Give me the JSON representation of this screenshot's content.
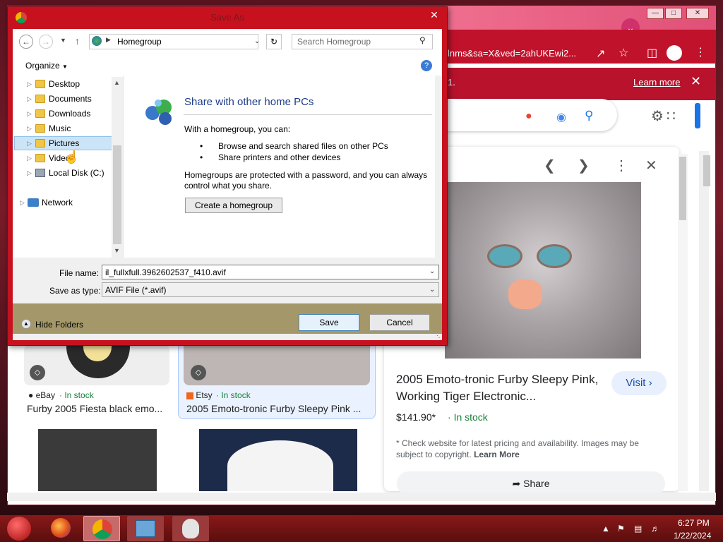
{
  "dialog": {
    "title": "Save As",
    "address": "Homegroup",
    "search_placeholder": "Search Homegroup",
    "organize_label": "Organize",
    "tree": [
      "Desktop",
      "Documents",
      "Downloads",
      "Music",
      "Pictures",
      "Videos",
      "Local Disk (C:)",
      "Network"
    ],
    "heading": "Share with other home PCs",
    "intro": "With a homegroup, you can:",
    "bullets": [
      "Browse and search shared files on other PCs",
      "Share printers and other devices"
    ],
    "protected_text": "Homegroups are protected with a password, and you can always control what you share.",
    "create_button": "Create a homegroup",
    "file_name_label": "File name:",
    "file_name_value": "il_fullxfull.3962602537_f410.avif",
    "save_type_label": "Save as type:",
    "save_type_value": "AVIF File (*.avif)",
    "hide_folders": "Hide Folders",
    "save_button": "Save",
    "cancel_button": "Cancel"
  },
  "browser": {
    "url_fragment": "lnms&sa=X&ved=2ahUKEwi2...",
    "infobar_text": "1.",
    "learn_more": "Learn more"
  },
  "preview": {
    "title": "2005 Emoto-tronic Furby Sleepy Pink, Working Tiger Electronic...",
    "visit": "Visit",
    "price": "$141.90*",
    "stock": "In stock",
    "disclaimer_prefix": "* Check website for latest pricing and availability. Images may be subject to copyright.",
    "disclaimer_link": "Learn More",
    "share": "Share"
  },
  "results": [
    {
      "store": "eBay",
      "stock": "In stock",
      "title": "Furby 2005 Fiesta black emo..."
    },
    {
      "store": "Etsy",
      "stock": "In stock",
      "title": "2005 Emoto-tronic Furby Sleepy Pink ..."
    }
  ],
  "taskbar": {
    "time": "6:27 PM",
    "date": "1/22/2024"
  },
  "colors": {
    "dialog_frame": "#c7111f",
    "chrome_toolbar": "#c0122a",
    "link_green": "#188038"
  }
}
